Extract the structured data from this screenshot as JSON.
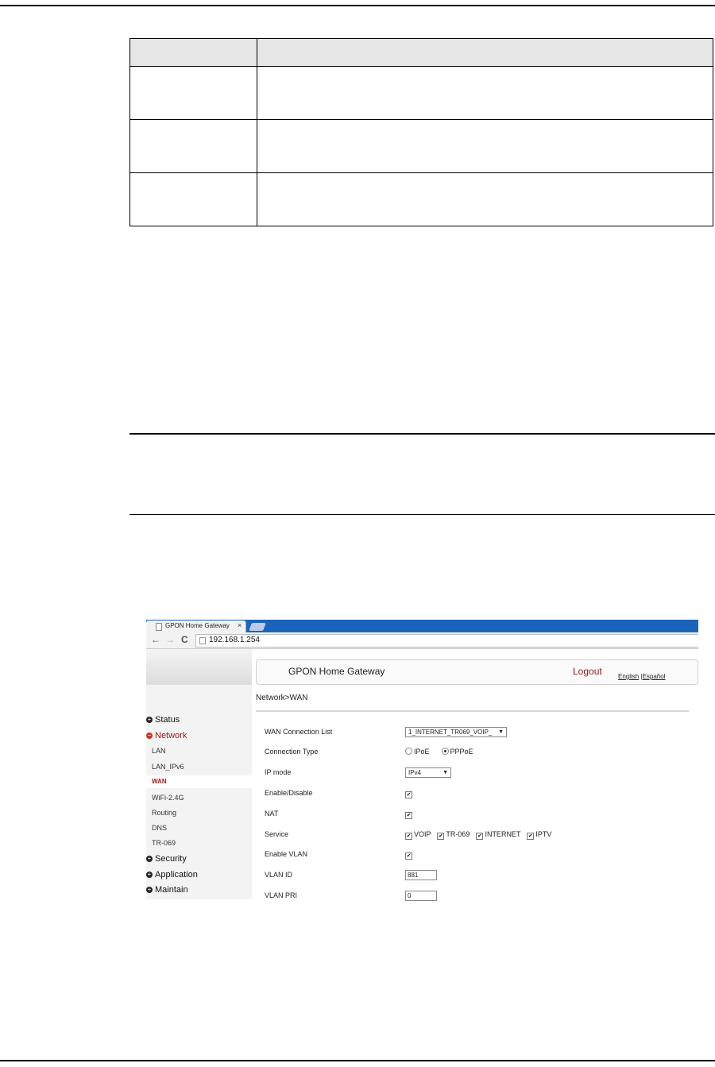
{
  "browser": {
    "tab_title": "GPON Home Gateway",
    "tab_close": "×",
    "url": "192.168.1.254"
  },
  "gateway": {
    "title": "GPON Home Gateway",
    "logout": "Logout",
    "lang_english": "English",
    "lang_separator": " |",
    "lang_spanish": "Español",
    "breadcrumb": "Network>WAN",
    "sidebar": {
      "status": "Status",
      "network": "Network",
      "network_items": [
        "LAN",
        "LAN_IPv6",
        "WAN",
        "WiFi-2.4G",
        "Routing",
        "DNS",
        "TR-069"
      ],
      "security": "Security",
      "application": "Application",
      "maintain": "Maintain"
    },
    "form": {
      "wan_connection_list_label": "WAN Connection List",
      "wan_connection_list_value": "1_INTERNET_TR069_VOIP_",
      "connection_type_label": "Connection Type",
      "connection_type_options": [
        "IPoE",
        "PPPoE"
      ],
      "connection_type_selected": "PPPoE",
      "ip_mode_label": "IP mode",
      "ip_mode_value": "IPv4",
      "enable_label": "Enable/Disable",
      "nat_label": "NAT",
      "service_label": "Service",
      "service_options": [
        "VOIP",
        "TR-069",
        "INTERNET",
        "IPTV"
      ],
      "enable_vlan_label": "Enable VLAN",
      "vlan_id_label": "VLAN ID",
      "vlan_id_value": "881",
      "vlan_pri_label": "VLAN PRI",
      "vlan_pri_value": "0"
    }
  }
}
